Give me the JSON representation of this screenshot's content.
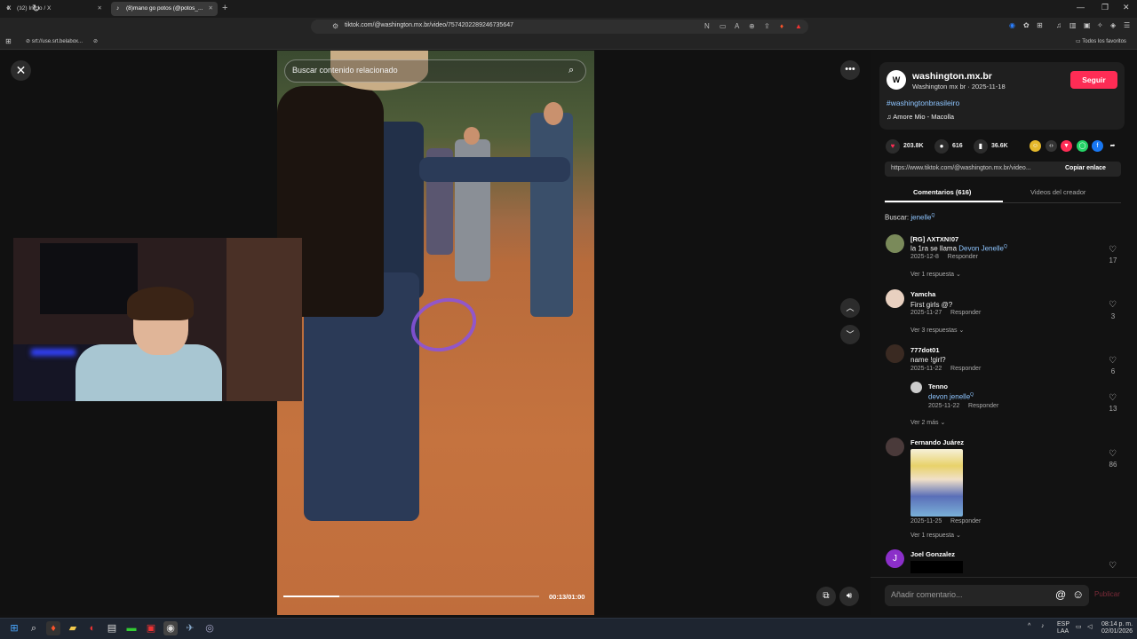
{
  "browser": {
    "tabs": [
      {
        "icon": "X",
        "label": "(12) Inicio / X"
      },
      {
        "icon": "♪",
        "label": "(8)mano go potos (@potos_..."
      }
    ],
    "url": "tiktok.com/@washington.mx.br/video/7574202289246735647",
    "bookmarks": [
      {
        "label": "srt://use.srt.belabox..."
      }
    ],
    "all_bookmarks_label": "Todos los favoritos"
  },
  "video": {
    "search_placeholder": "Buscar contenido relacionado",
    "time": "00:13/01:00",
    "progress": 0.22
  },
  "creator": {
    "avatar_letter": "W",
    "name": "washington.mx.br",
    "subtitle": "Washington mx br · 2025-11-18",
    "follow_label": "Seguir",
    "hashtag": "#washingtonbrasileiro",
    "music": "Amore Mio - Macolla"
  },
  "stats": {
    "likes": "203.8K",
    "comments": "616",
    "saves": "36.6K"
  },
  "share": {
    "link": "https://www.tiktok.com/@washington.mx.br/video...",
    "copy_label": "Copiar enlace"
  },
  "tabs": {
    "comments": "Comentarios (616)",
    "creator_videos": "Videos del creador"
  },
  "search": {
    "label": "Buscar:",
    "term": "jenelle"
  },
  "comments": [
    {
      "name": "[RG] ΛXTXN!07",
      "text_prefix": "la 1ra se llama ",
      "text_link": "Devon Jenelle",
      "date": "2025-12-8",
      "reply": "Responder",
      "likes": "17",
      "more": "Ver 1 respuesta"
    },
    {
      "name": "Yamcha",
      "text_prefix": "First girls @?",
      "text_link": "",
      "date": "2025-11-27",
      "reply": "Responder",
      "likes": "3",
      "more": "Ver 3 respuestas"
    },
    {
      "name": "777dot01",
      "text_prefix": "name !girl?",
      "text_link": "",
      "date": "2025-11-22",
      "reply": "Responder",
      "likes": "6",
      "more": ""
    },
    {
      "name": "Tenno",
      "text_prefix": "",
      "text_link": "devon jenelle",
      "date": "2025-11-22",
      "reply": "Responder",
      "likes": "13",
      "more": "Ver 2 más"
    },
    {
      "name": "Fernando Juárez",
      "text_prefix": "",
      "text_link": "",
      "date": "2025-11-25",
      "reply": "Responder",
      "likes": "86",
      "more": "Ver 1 respuesta"
    },
    {
      "name": "Joel Gonzalez",
      "avatar_letter": "J",
      "text_prefix": "",
      "text_link": "",
      "date": "",
      "reply": "",
      "likes": "",
      "more": ""
    }
  ],
  "comment_input": {
    "placeholder": "Añadir comentario...",
    "post_label": "Publicar"
  },
  "taskbar": {
    "lang": "ESP",
    "lang2": "LAA",
    "time": "08:14 p. m.",
    "date": "02/01/2026"
  },
  "colors": {
    "accent": "#fe2c55",
    "link": "#8ec5ff"
  }
}
